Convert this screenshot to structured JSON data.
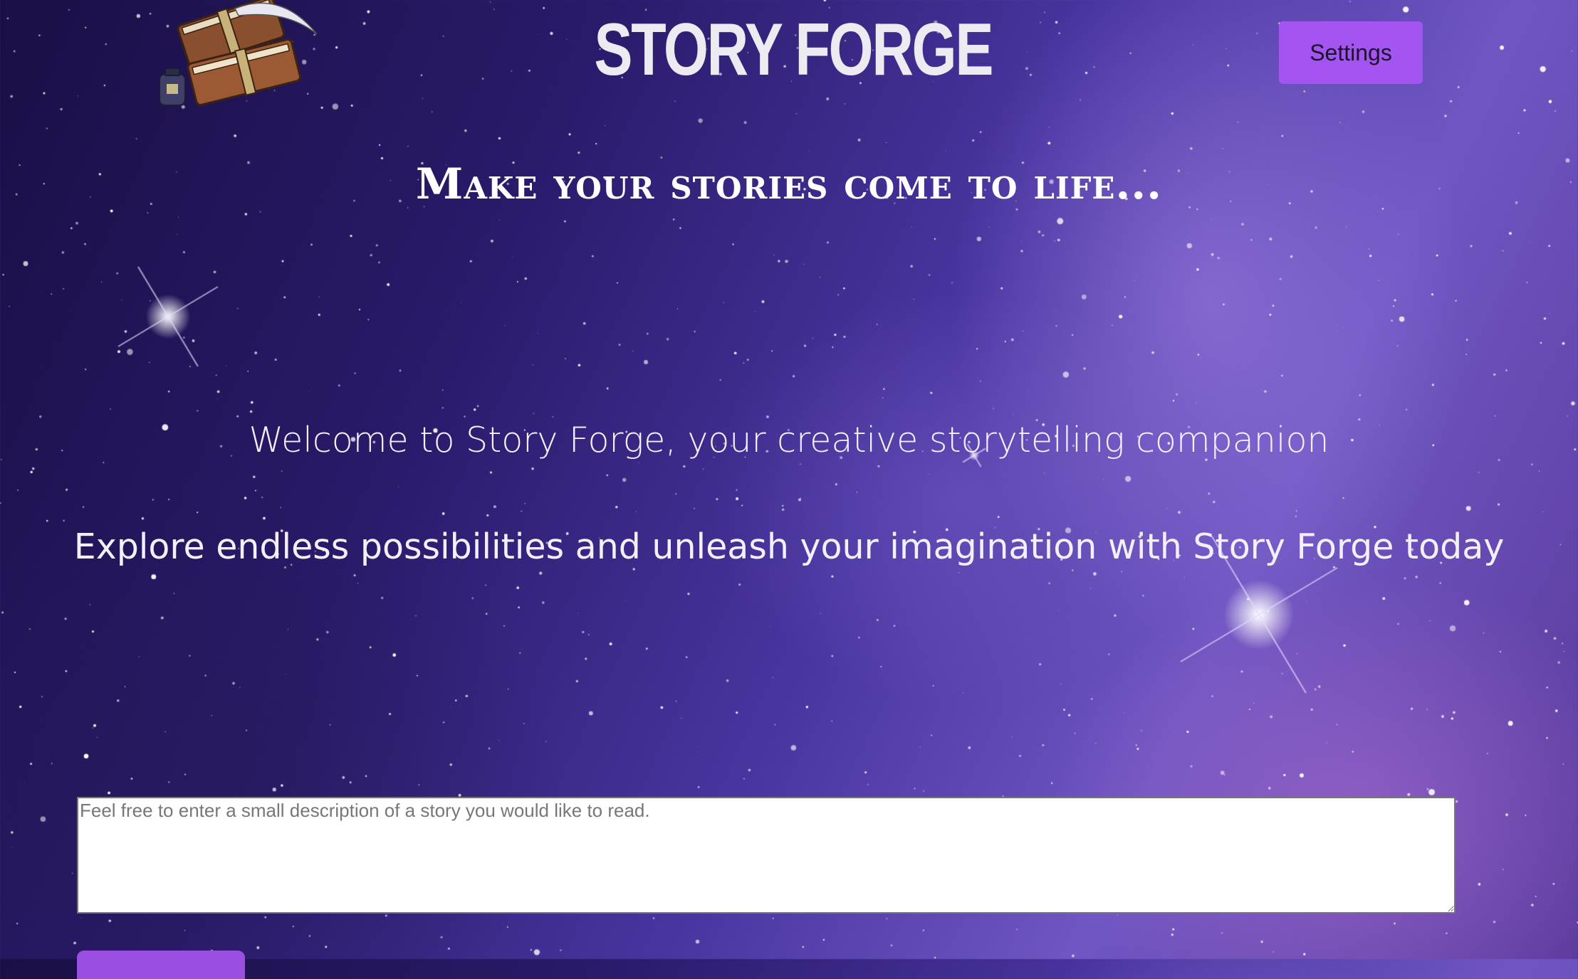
{
  "header": {
    "title": "STORY FORGE",
    "settings_label": "Settings"
  },
  "hero": {
    "tagline": "Make your stories come to life...",
    "welcome": "Welcome to Story Forge, your creative storytelling companion",
    "explore": "Explore endless possibilities and unleash your imagination with Story Forge today"
  },
  "story_form": {
    "placeholder": "Feel free to enter a small description of a story you would like to read.",
    "value": ""
  },
  "colors": {
    "accent": "#a454f0",
    "title_text": "#ecebf2",
    "background_deep": "#1a0f45",
    "background_nebula": "#6f56c2"
  },
  "icons": {
    "logo": "books-quill-inkwell-icon"
  }
}
